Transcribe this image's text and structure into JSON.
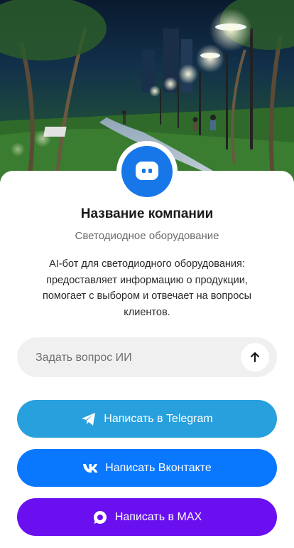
{
  "company": {
    "name": "Название компании",
    "category": "Светодиодное оборудование",
    "description": "AI-бот для светодиодного оборудования: предоставляет информацию о продукции, помогает с выбором и отвечает на вопросы клиентов."
  },
  "ask": {
    "placeholder": "Задать вопрос ИИ",
    "value": ""
  },
  "buttons": {
    "telegram": {
      "label": "Написать в Telegram",
      "color": "#28a0de"
    },
    "vk": {
      "label": "Написать Вконтакте",
      "color": "#0a77ff"
    },
    "max": {
      "label": "Написать в MAX",
      "color": "#6a10f0"
    }
  },
  "icons": {
    "avatar": "chat-bot-icon",
    "send": "arrow-up-icon",
    "telegram": "telegram-icon",
    "vk": "vk-icon",
    "max": "max-icon"
  },
  "colors": {
    "accent": "#1877e8"
  }
}
